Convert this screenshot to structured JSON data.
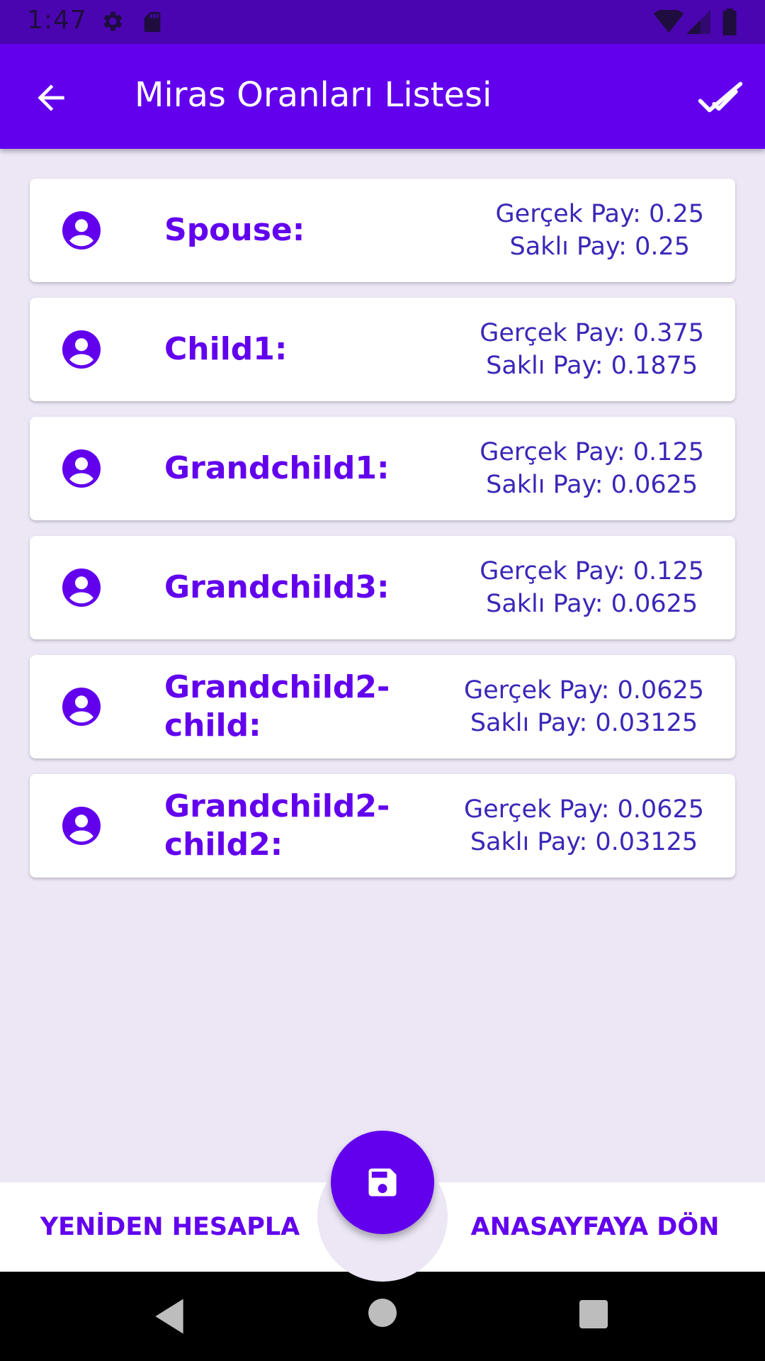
{
  "status_bar": {
    "time": "1:47",
    "icons": [
      "settings-icon",
      "sd-card-icon",
      "wifi-icon",
      "signal-icon",
      "battery-icon"
    ]
  },
  "app_bar": {
    "title": "Miras Oranları Listesi",
    "back_icon": "arrow-back-icon",
    "action_icon": "done-all-icon"
  },
  "heirs": [
    {
      "name": "Spouse:",
      "real_share": "Gerçek Pay: 0.25",
      "reserved_share": "Saklı Pay: 0.25"
    },
    {
      "name": "Child1:",
      "real_share": "Gerçek Pay: 0.375",
      "reserved_share": "Saklı Pay: 0.1875"
    },
    {
      "name": "Grandchild1:",
      "real_share": "Gerçek Pay: 0.125",
      "reserved_share": "Saklı Pay: 0.0625"
    },
    {
      "name": "Grandchild3:",
      "real_share": "Gerçek Pay: 0.125",
      "reserved_share": "Saklı Pay: 0.0625"
    },
    {
      "name": "Grandchild2-child:",
      "real_share": "Gerçek Pay: 0.0625",
      "reserved_share": "Saklı Pay: 0.03125"
    },
    {
      "name": "Grandchild2-child2:",
      "real_share": "Gerçek Pay: 0.0625",
      "reserved_share": "Saklı Pay: 0.03125"
    }
  ],
  "bottom": {
    "recalculate_label": "YENİDEN HESAPLA",
    "home_label": "ANASAYFAYA DÖN",
    "fab_icon": "save-icon"
  },
  "colors": {
    "primary": "#6200ee",
    "status_bar": "#4a05b0",
    "background": "#ece6f5",
    "share_text": "#3a28b8"
  }
}
